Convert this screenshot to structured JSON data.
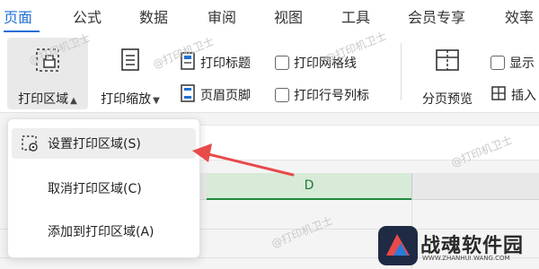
{
  "tabs": [
    {
      "label": "页面",
      "active": true
    },
    {
      "label": "公式",
      "active": false
    },
    {
      "label": "数据",
      "active": false
    },
    {
      "label": "审阅",
      "active": false
    },
    {
      "label": "视图",
      "active": false
    },
    {
      "label": "工具",
      "active": false
    },
    {
      "label": "会员专享",
      "active": false
    },
    {
      "label": "效率",
      "active": false
    }
  ],
  "ribbon": {
    "print_area": {
      "label": "打印区域",
      "icon": "print-area-icon"
    },
    "print_scale": {
      "label": "打印缩放",
      "icon": "print-scale-icon"
    },
    "print_titles": {
      "label": "打印标题",
      "icon": "print-titles-icon"
    },
    "header_footer": {
      "label": "页眉页脚",
      "icon": "header-footer-icon"
    },
    "print_gridlines": {
      "label": "打印网格线",
      "checked": false
    },
    "print_row_col_headers": {
      "label": "打印行号列标",
      "checked": false
    },
    "page_break_preview": {
      "label": "分页预览",
      "icon": "page-break-preview-icon"
    },
    "show_partial": {
      "label": "显示",
      "checked": false
    },
    "insert_partial": {
      "label": "插入",
      "icon": "insert-icon"
    }
  },
  "dropdown": {
    "items": [
      {
        "label": "设置打印区域(S)",
        "icon": "set-print-area-icon"
      },
      {
        "label": "取消打印区域(C)"
      },
      {
        "label": "添加到打印区域(A)"
      }
    ]
  },
  "sheet": {
    "column_label": "D"
  },
  "watermark": "@打印机卫士",
  "logo": {
    "name": "战魂软件园",
    "url": "WWW.ZHANHUI.WANG.COM"
  },
  "colors": {
    "accent": "#1f6fd6",
    "arrow": "#e84a4a",
    "column_selected": "#1e8a3c"
  }
}
